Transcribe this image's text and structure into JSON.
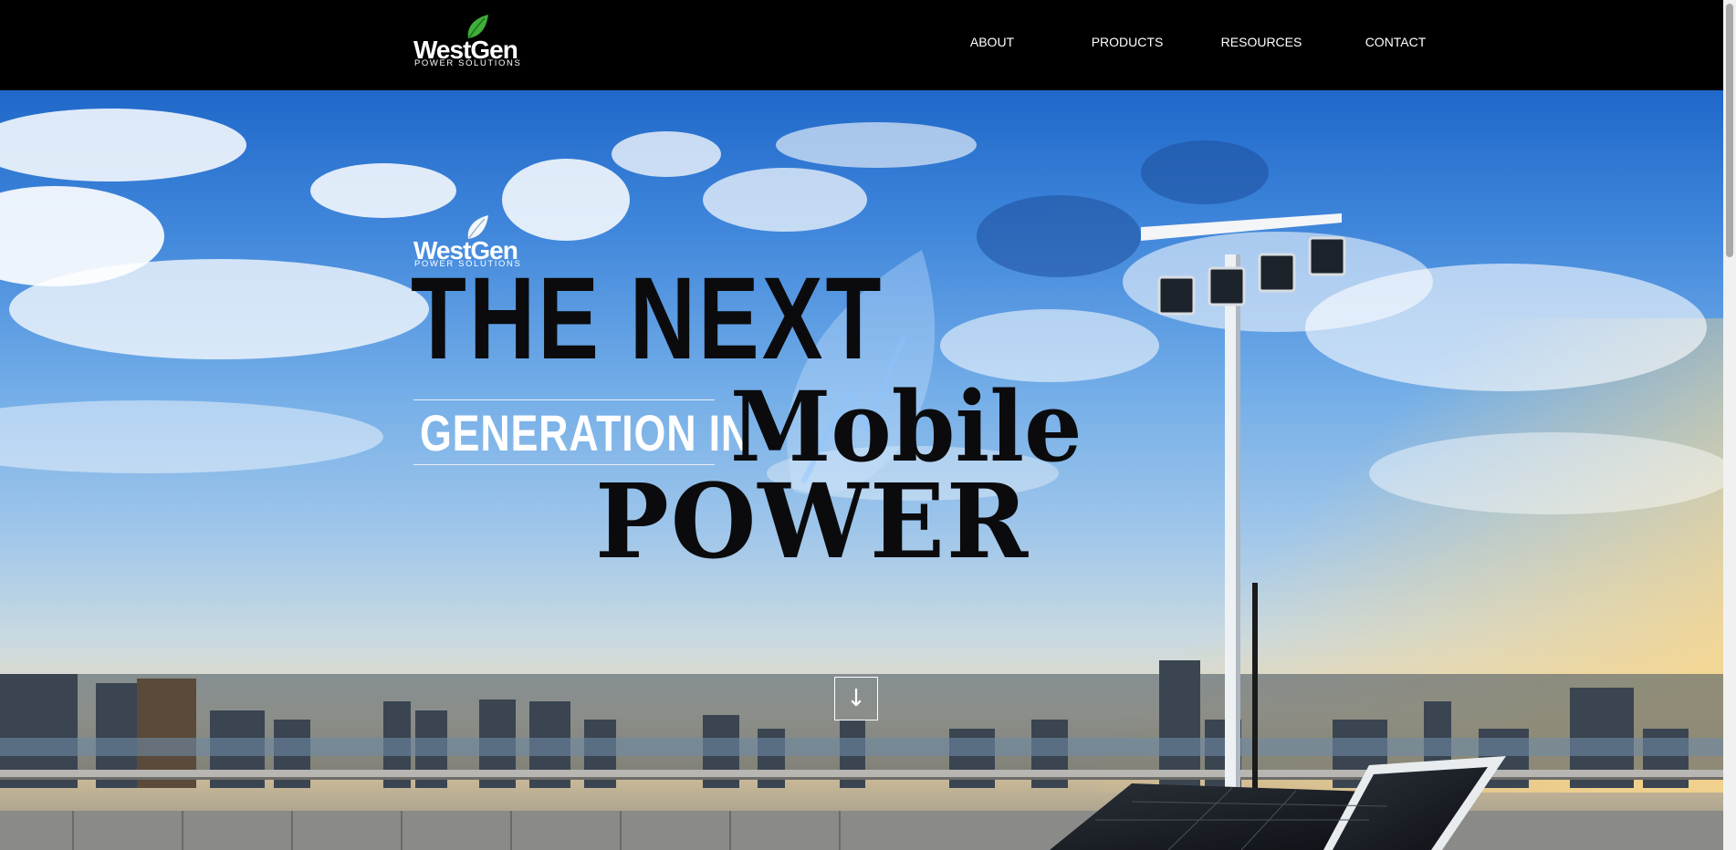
{
  "header": {
    "logo": {
      "word": "WestGen",
      "sub": "POWER SOLUTIONS",
      "icon": "leaf-icon",
      "leaf_color": "#3fae3a"
    },
    "nav": [
      {
        "label": "ABOUT"
      },
      {
        "label": "PRODUCTS"
      },
      {
        "label": "RESOURCES"
      },
      {
        "label": "CONTACT"
      }
    ]
  },
  "hero": {
    "logo": {
      "word": "WestGen",
      "sub": "POWER SOLUTIONS",
      "icon": "leaf-icon"
    },
    "headline_line1": "THE NEXT",
    "headline_line2": "GENERATION IN",
    "headline_line3": "Mobile",
    "headline_line4": "POWER",
    "scroll_button_icon": "arrow-down-icon",
    "scroll_button_glyph": "↓"
  },
  "colors": {
    "header_bg": "#000000",
    "headline_dark": "#0b0b0d",
    "headline_light": "#ffffff",
    "sky_top": "#1f68c9"
  }
}
